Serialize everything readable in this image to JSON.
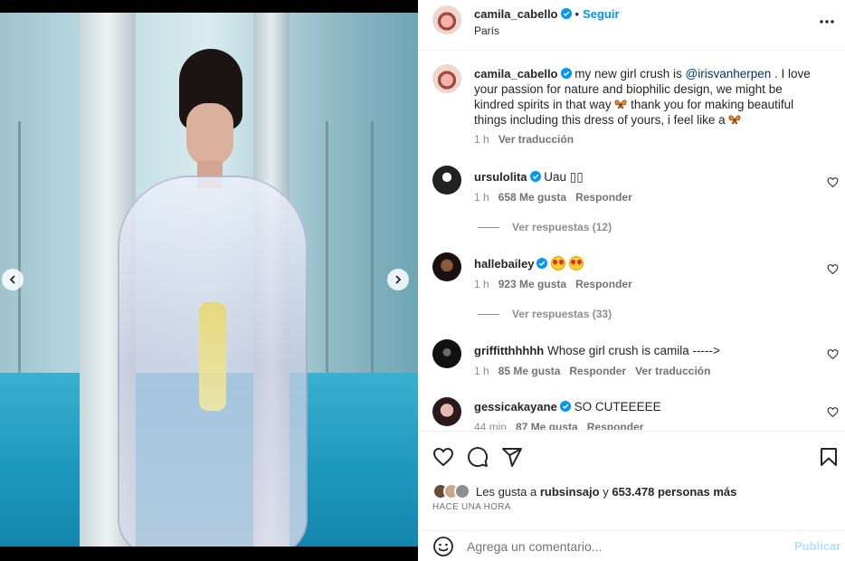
{
  "header": {
    "username": "camila_cabello",
    "dot": "•",
    "follow_label": "Seguir",
    "location": "París"
  },
  "caption": {
    "username": "camila_cabello",
    "text_1": " my new girl crush is ",
    "mention": "@irisvanherpen",
    "text_2": " . I love your passion for nature and biophilic design, we might be kindred spirits in that way ",
    "text_3": " thank you for making beautiful things including this dress of yours, i feel like a ",
    "time": "1 h",
    "translate": "Ver traducción"
  },
  "comments": [
    {
      "username": "ursulolita",
      "text": "Uau ▯▯",
      "time": "1 h",
      "likes": "658 Me gusta",
      "reply": "Responder",
      "view_replies": "Ver respuestas (12)"
    },
    {
      "username": "hallebailey",
      "text": "",
      "time": "1 h",
      "likes": "923 Me gusta",
      "reply": "Responder",
      "view_replies": "Ver respuestas (33)"
    },
    {
      "username": "griffitthhhhh",
      "text": "Whose girl crush is camila ----->",
      "time": "1 h",
      "likes": "85 Me gusta",
      "reply": "Responder",
      "translate": "Ver traducción"
    },
    {
      "username": "gessicakayane",
      "text": "SO CUTEEEEE",
      "time": "44 min",
      "likes": "87 Me gusta",
      "reply": "Responder"
    }
  ],
  "likes_line": {
    "prefix": "Les gusta a",
    "user": "rubsinsajo",
    "connector": "y",
    "others": "653.478 personas más"
  },
  "timestamp": "HACE UNA HORA",
  "composer": {
    "placeholder": "Agrega un comentario...",
    "post_label": "Publicar"
  },
  "icons": {
    "more": "more-horizontal-icon",
    "like": "heart-icon",
    "comment": "comment-icon",
    "share": "send-icon",
    "save": "bookmark-icon",
    "emoji": "emoji-icon"
  },
  "colors": {
    "accent": "#0095f6",
    "verified": "#0095f6",
    "post_disabled": "#b2dffc"
  }
}
